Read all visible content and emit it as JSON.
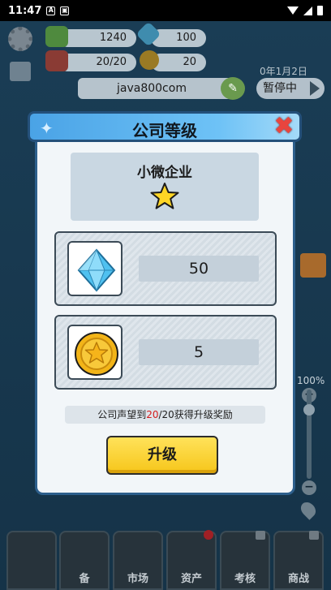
{
  "status_bar": {
    "time": "11:47",
    "notif_icons": [
      "A",
      "▣"
    ]
  },
  "resources": {
    "cash": "1240",
    "diamonds": "100",
    "staff": "20/20",
    "coins": "20"
  },
  "company": {
    "name": "java800com",
    "date": "0年1月2日",
    "pause_label": "暂停中"
  },
  "zoom": {
    "percent": "100%",
    "plus": "+",
    "minus": "−"
  },
  "nav": {
    "items": [
      {
        "label": ""
      },
      {
        "label": "备"
      },
      {
        "label": "市场"
      },
      {
        "label": "资产"
      },
      {
        "label": "考核"
      },
      {
        "label": "商战"
      }
    ]
  },
  "modal": {
    "title": "公司等级",
    "close_symbol": "✖",
    "tier_name": "小微企业",
    "tier_stars": 1,
    "rewards": [
      {
        "icon": "diamond-icon",
        "value": "50"
      },
      {
        "icon": "coin-icon",
        "value": "5"
      }
    ],
    "reputation": {
      "prefix": "公司声望到",
      "current": "20",
      "suffix": "/20获得升级奖励"
    },
    "upgrade_label": "升级"
  },
  "colors": {
    "accent_blue": "#4aa3e6",
    "upgrade_yellow": "#f6c61a",
    "close_red": "#e8453e",
    "rep_red": "#d41c1c"
  }
}
